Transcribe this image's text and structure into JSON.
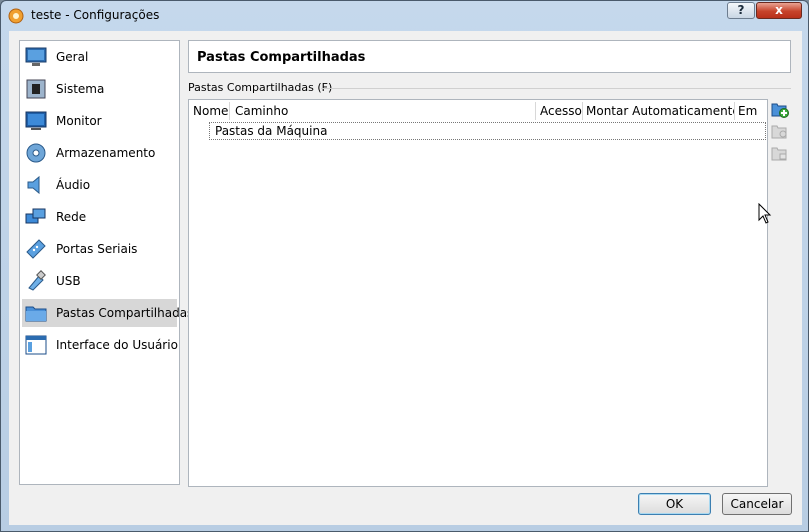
{
  "window": {
    "title": "teste - Configurações",
    "help_label": "?",
    "close_label": "x"
  },
  "sidebar": {
    "items": [
      {
        "label": "Geral",
        "icon": "general-monitor-icon"
      },
      {
        "label": "Sistema",
        "icon": "chip-icon"
      },
      {
        "label": "Monitor",
        "icon": "display-icon"
      },
      {
        "label": "Armazenamento",
        "icon": "disk-icon"
      },
      {
        "label": "Áudio",
        "icon": "speaker-icon"
      },
      {
        "label": "Rede",
        "icon": "network-icon"
      },
      {
        "label": "Portas Seriais",
        "icon": "serial-port-icon"
      },
      {
        "label": "USB",
        "icon": "usb-icon"
      },
      {
        "label": "Pastas Compartilhadas",
        "icon": "folder-icon",
        "selected": true
      },
      {
        "label": "Interface do Usuário",
        "icon": "ui-window-icon"
      }
    ]
  },
  "page": {
    "title": "Pastas Compartilhadas",
    "group_label": "Pastas Compartilhadas (F)"
  },
  "table": {
    "columns": [
      "Nome",
      "Caminho",
      "Acesso",
      "Montar Automaticamente",
      "Em"
    ],
    "rows": [
      "Pastas da Máquina"
    ]
  },
  "toolbar": {
    "add_icon": "add-folder-icon",
    "edit_icon": "edit-folder-icon",
    "remove_icon": "remove-folder-icon"
  },
  "footer": {
    "ok_label": "OK",
    "cancel_label": "Cancelar"
  },
  "colors": {
    "selected_bg": "#d7d7d7",
    "ok_border": "#3c7fb1"
  }
}
